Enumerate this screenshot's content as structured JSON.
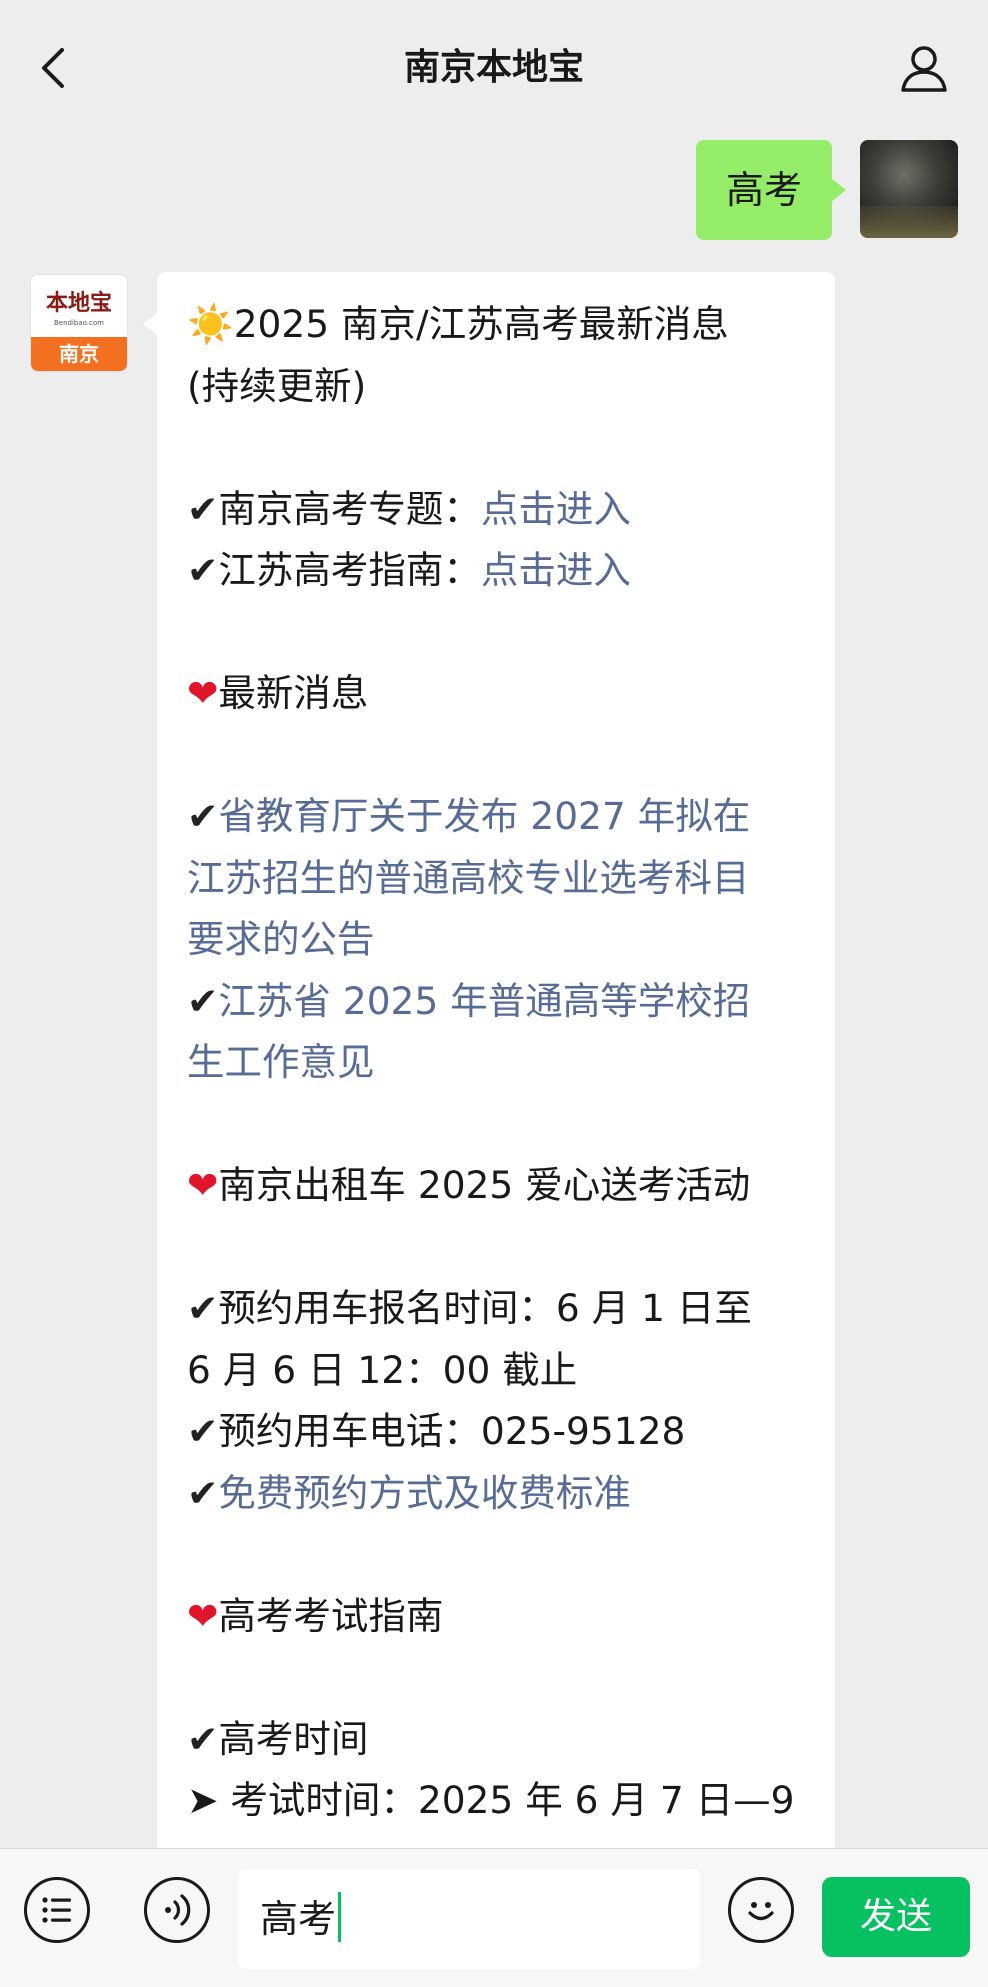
{
  "header": {
    "title": "南京本地宝"
  },
  "my_message": {
    "text": "高考"
  },
  "bot_avatar": {
    "logo_text": "本地宝",
    "logo_url": "Bendibao.com",
    "city": "南京"
  },
  "bot_message": {
    "title_icon": "☀️",
    "title": "2025 南京/江苏高考最新消息",
    "title_cont": "(持续更新)",
    "check": "✔",
    "heart": "❤",
    "arrow": "➤",
    "topic1_label": "南京高考专题：",
    "topic1_link": "点击进入",
    "topic2_label": "江苏高考指南：",
    "topic2_link": "点击进入",
    "section_latest": "最新消息",
    "news1_l1": "省教育厅关于发布 2027 年拟在",
    "news1_l2": "江苏招生的普通高校专业选考科目",
    "news1_l3": "要求的公告",
    "news2_l1": "江苏省 2025 年普通高等学校招",
    "news2_l2": "生工作意见",
    "section_taxi": "南京出租车 2025 爱心送考活动",
    "taxi1_l1": "预约用车报名时间：6 月 1 日至",
    "taxi1_l2": "6 月 6 日 12：00 截止",
    "taxi2": "预约用车电话：025-95128",
    "taxi3_link": "免费预约方式及收费标准",
    "section_guide": "高考考试指南",
    "guide1": "高考时间",
    "guide2": "考试时间：2025 年 6 月 7 日—9"
  },
  "input_bar": {
    "value": "高考",
    "send_label": "发送"
  }
}
